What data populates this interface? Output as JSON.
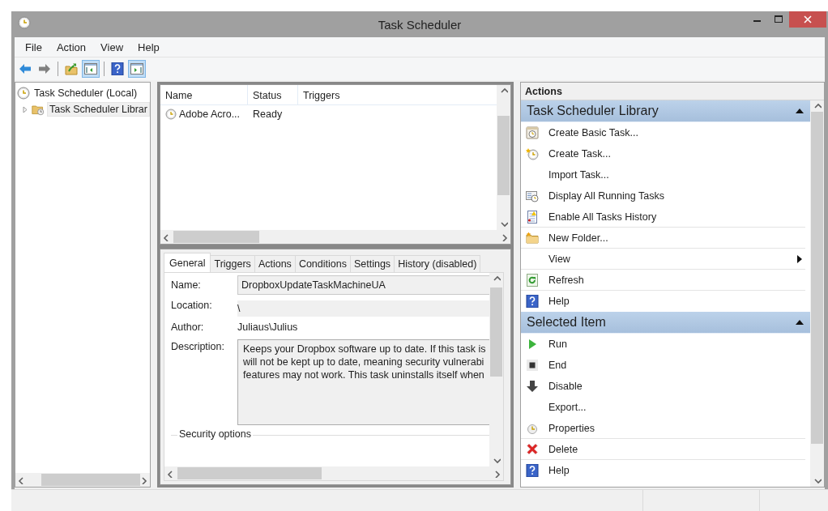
{
  "window": {
    "title": "Task Scheduler"
  },
  "menu": [
    "File",
    "Action",
    "View",
    "Help"
  ],
  "toolbar": [
    {
      "kind": "back",
      "pressed": false
    },
    {
      "kind": "forward",
      "pressed": false
    },
    {
      "kind": "separator"
    },
    {
      "kind": "folder-up",
      "pressed": false
    },
    {
      "kind": "tree-pane",
      "pressed": true
    },
    {
      "kind": "separator"
    },
    {
      "kind": "help",
      "pressed": false
    },
    {
      "kind": "action-pane",
      "pressed": true
    }
  ],
  "tree": [
    {
      "label": "Task Scheduler (Local)",
      "selected": false,
      "children": [
        {
          "label": "Task Scheduler Librar",
          "expanded": false,
          "selected": true
        }
      ]
    }
  ],
  "task_list": {
    "columns": [
      "Name",
      "Status",
      "Triggers"
    ],
    "rows": [
      {
        "name": "Adobe Acro...",
        "status": "Ready"
      }
    ]
  },
  "details": {
    "tabs": [
      {
        "label": "General",
        "selected": true
      },
      {
        "label": "Triggers",
        "selected": false
      },
      {
        "label": "Actions",
        "selected": false
      },
      {
        "label": "Conditions",
        "selected": false
      },
      {
        "label": "Settings",
        "selected": false
      },
      {
        "label": "History (disabled)",
        "selected": false
      }
    ],
    "fields": [
      {
        "kind": "field",
        "label": "Name:",
        "value": "DropboxUpdateTaskMachineUA"
      },
      {
        "kind": "shaded",
        "label": "Location:",
        "value": "\\"
      },
      {
        "kind": "plain",
        "label": "Author:",
        "value": "Juliaus\\Julius"
      },
      {
        "kind": "textarea",
        "label": "Description:",
        "lines": [
          "Keeps your Dropbox software up to date. If this task is",
          "will not be kept up to date, meaning security vulnerabi",
          "features may not work. This task uninstalls itself when"
        ]
      }
    ],
    "security_options": "Security options"
  },
  "actions": {
    "title": "Actions",
    "sections": [
      {
        "title": "Task Scheduler Library",
        "expanded": true,
        "items": [
          {
            "label": "Create Basic Task...",
            "submenu": false,
            "divider": false
          },
          {
            "label": "Create Task...",
            "submenu": false,
            "divider": false
          },
          {
            "label": "Import Task...",
            "submenu": false,
            "divider": false
          },
          {
            "label": "Display All Running Tasks",
            "submenu": false,
            "divider": false
          },
          {
            "label": "Enable All Tasks History",
            "submenu": false,
            "divider": true
          },
          {
            "label": "New Folder...",
            "submenu": false,
            "divider": true
          },
          {
            "label": "View",
            "submenu": true,
            "divider": true
          },
          {
            "label": "Refresh",
            "submenu": false,
            "divider": true
          },
          {
            "label": "Help",
            "submenu": false,
            "divider": false
          }
        ]
      },
      {
        "title": "Selected Item",
        "expanded": true,
        "items": [
          {
            "label": "Run",
            "submenu": false,
            "divider": false
          },
          {
            "label": "End",
            "submenu": false,
            "divider": false
          },
          {
            "label": "Disable",
            "submenu": false,
            "divider": false
          },
          {
            "label": "Export...",
            "submenu": false,
            "divider": false
          },
          {
            "label": "Properties",
            "submenu": false,
            "divider": true
          },
          {
            "label": "Delete",
            "submenu": false,
            "divider": true
          },
          {
            "label": "Help",
            "submenu": false,
            "divider": false
          }
        ]
      }
    ]
  }
}
